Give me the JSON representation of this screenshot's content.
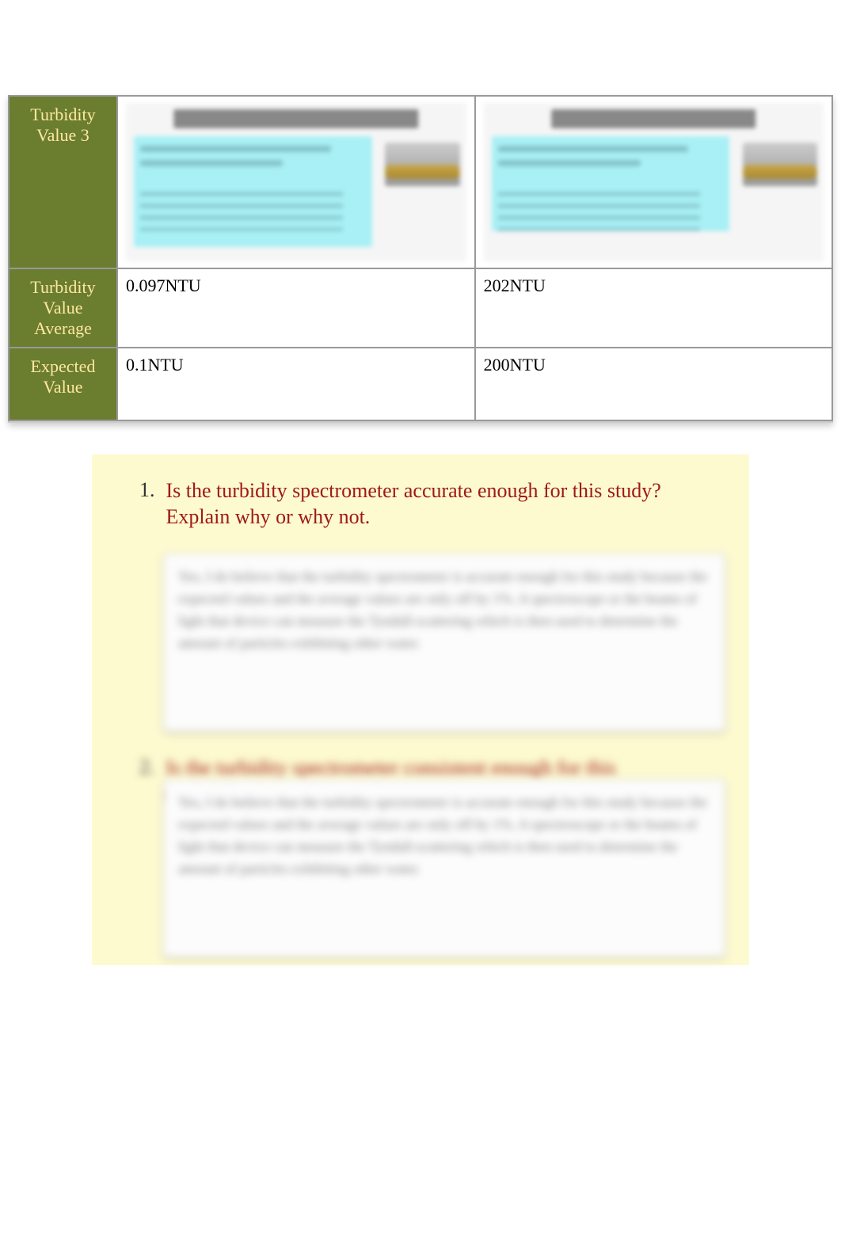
{
  "table": {
    "rows": [
      {
        "label": "Turbidity Value 3",
        "col1_image": true,
        "col2_image": true
      },
      {
        "label": "Turbidity Value Average",
        "col1": "0.097NTU",
        "col2": "202NTU"
      },
      {
        "label": "Expected Value",
        "col1": "0.1NTU",
        "col2": "200NTU"
      }
    ]
  },
  "questions": [
    {
      "num": "1.",
      "text": "Is the turbidity spectrometer accurate enough for this study?     Explain why or why not.",
      "answer": "Yes, I do believe that the turbidity spectrometer is accurate enough for this study because the expected values and the average values are only off by 1%. A spectroscope or the beams of light that device can measure the Tyndall-scattering which is then used to determine the amount of particles exhibiting other water."
    },
    {
      "num": "2.",
      "text": "Is the turbidity spectrometer consistent enough for this study? Explain why or why not.",
      "answer": "Yes, I do believe that the turbidity spectrometer is accurate enough for this study because the expected values and the average values are only off by 1%. A spectroscope or the beams of light that device can measure the Tyndall-scattering which is then used to determine the amount of particles exhibiting other water."
    }
  ]
}
